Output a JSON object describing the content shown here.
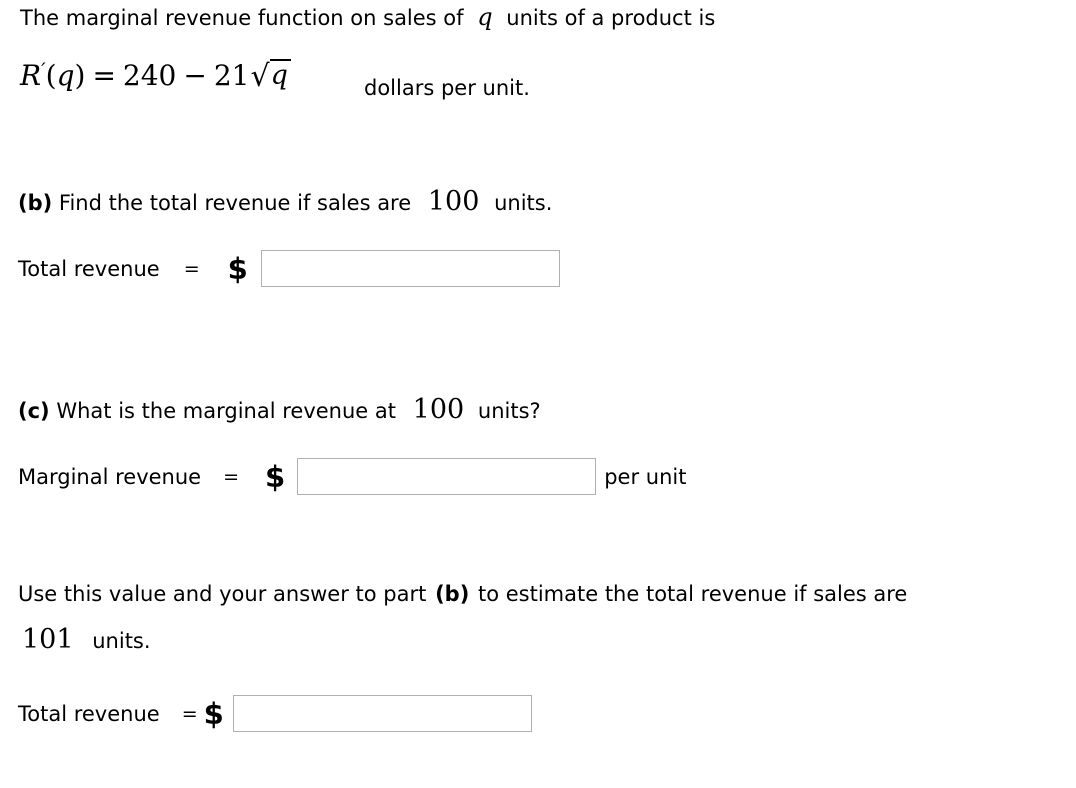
{
  "problem": {
    "intro": {
      "text_before_var": "The marginal revenue function on sales of",
      "variable": "q",
      "text_after_var": "units of a product is"
    },
    "equation": {
      "function_name": "R",
      "prime": "′",
      "open_paren": "(",
      "arg": "q",
      "close_paren": ")",
      "equals": "=",
      "constant": "240",
      "minus": "−",
      "coefficient": "21",
      "radical_sign": "√",
      "radicand": "q",
      "trailer": "dollars per unit."
    },
    "parts": [
      {
        "label": "(b)",
        "question_before_value": "Find the total revenue if sales are",
        "value": "100",
        "question_after_value": "units.",
        "answer_label": "Total revenue",
        "equals": "=",
        "currency": "$",
        "input_value": "",
        "input_placeholder": "",
        "suffix": ""
      },
      {
        "label": "(c)",
        "question_before_value": "What is the marginal revenue at",
        "value": "100",
        "question_after_value": "units?",
        "answer_label": "Marginal revenue",
        "equals": "=",
        "currency": "$",
        "input_value": "",
        "input_placeholder": "",
        "suffix": "per unit"
      }
    ],
    "followup": {
      "text_part1": "Use this value and your answer to part",
      "bold_ref": "(b)",
      "text_part2": "to estimate the total revenue if sales are",
      "value": "101",
      "text_part3": "units.",
      "answer_label": "Total revenue",
      "equals": "=",
      "currency": "$",
      "input_value": "",
      "input_placeholder": ""
    }
  },
  "colors": {
    "text": "#000000",
    "input_border": "#b0b0b0",
    "background": "#ffffff"
  }
}
